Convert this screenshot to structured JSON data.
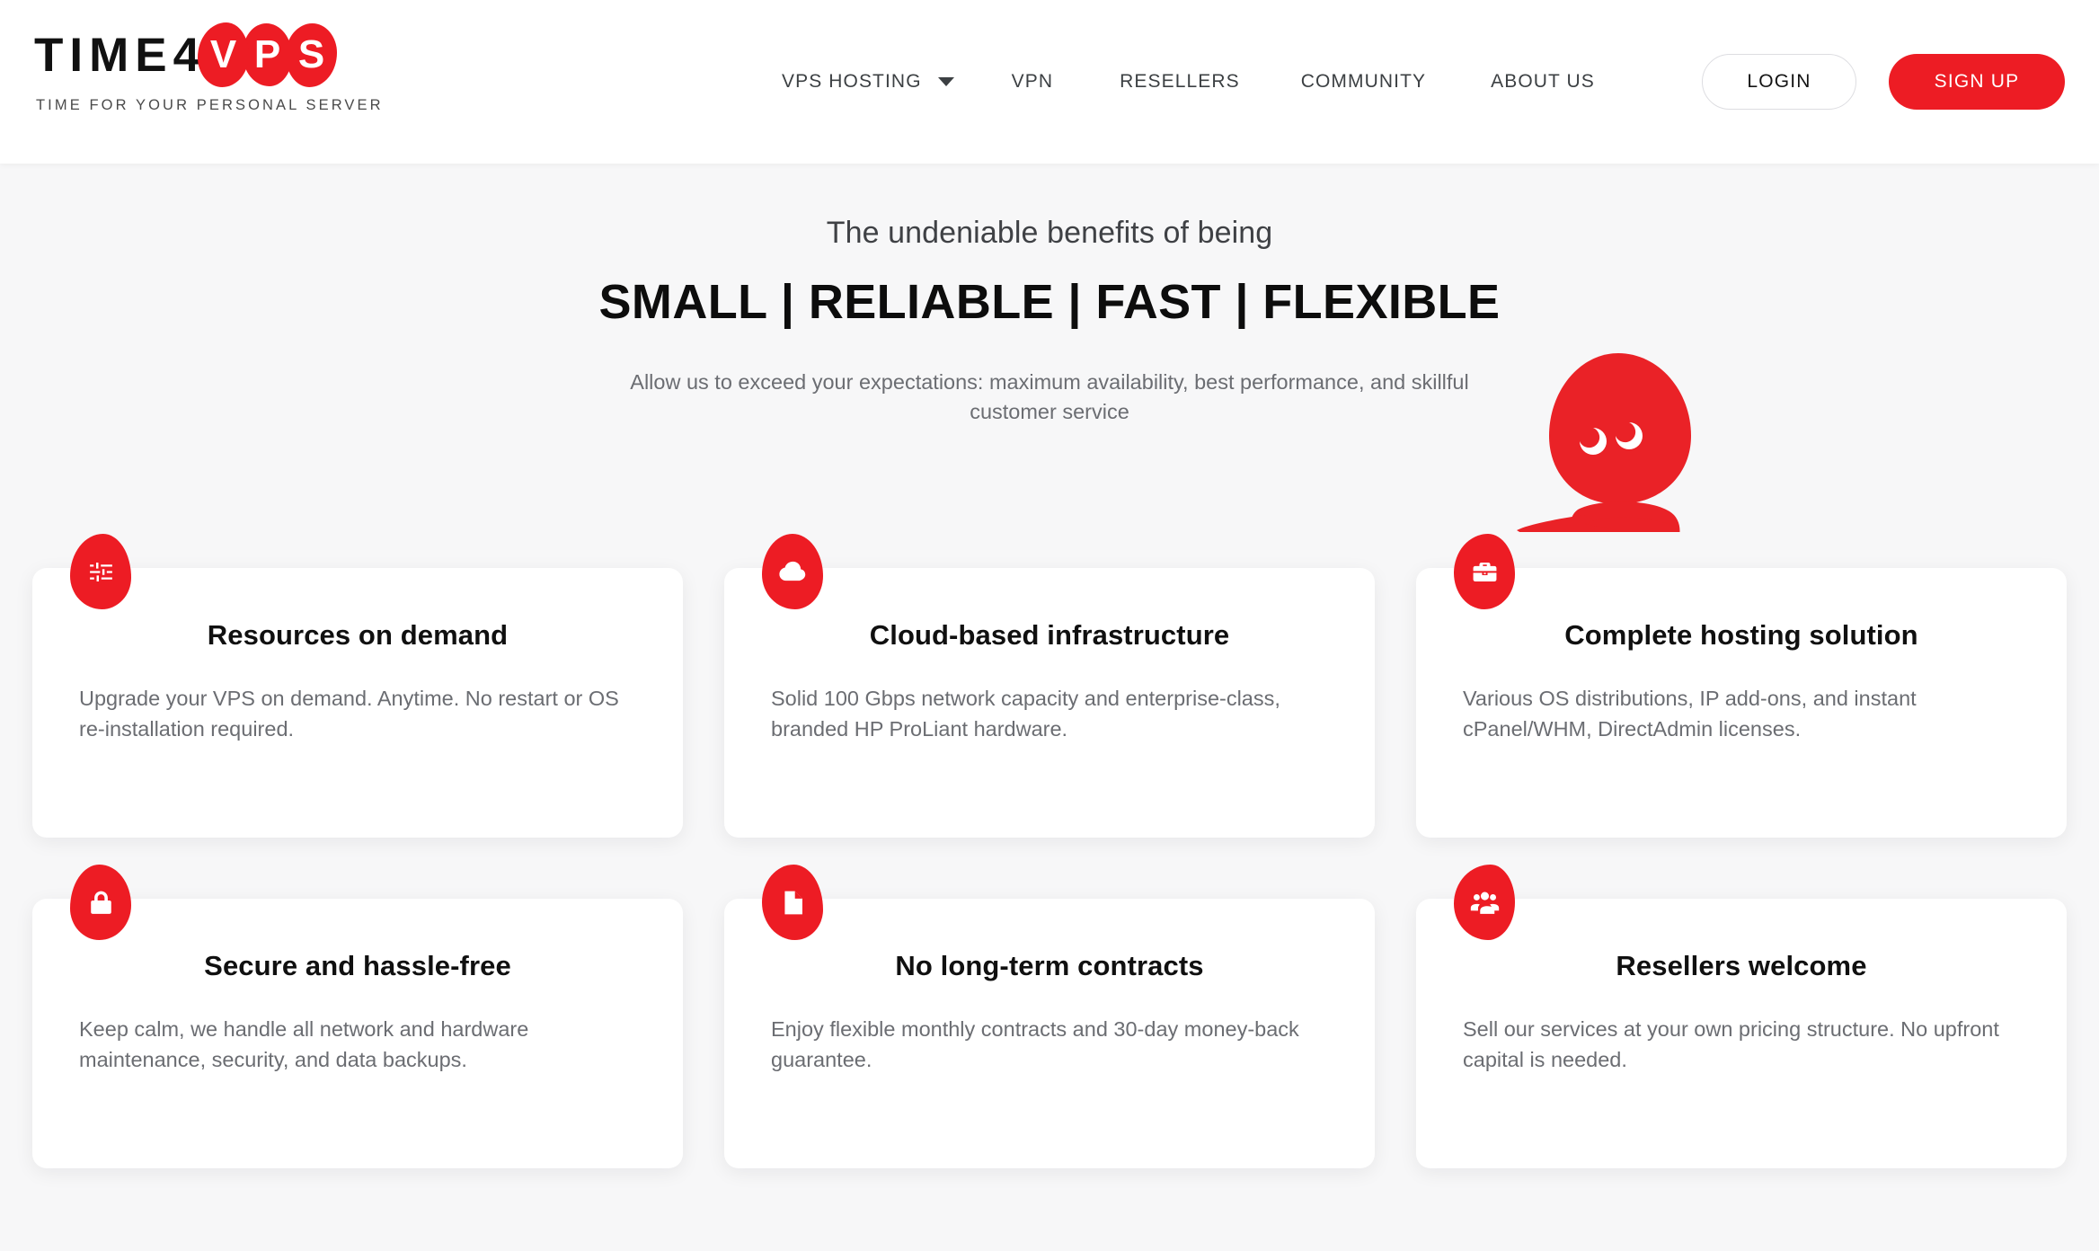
{
  "brand": {
    "name_dark": "TIME4",
    "blobs": [
      "V",
      "P",
      "S"
    ],
    "tagline": "TIME FOR YOUR PERSONAL SERVER",
    "accent_color": "#ed1c24"
  },
  "nav": {
    "items": [
      {
        "label": "VPS HOSTING",
        "has_dropdown": true
      },
      {
        "label": "VPN",
        "has_dropdown": false
      },
      {
        "label": "RESELLERS",
        "has_dropdown": false
      },
      {
        "label": "COMMUNITY",
        "has_dropdown": false
      },
      {
        "label": "ABOUT US",
        "has_dropdown": false
      }
    ],
    "login_label": "LOGIN",
    "signup_label": "SIGN UP"
  },
  "hero": {
    "kicker": "The undeniable benefits of being",
    "title": "SMALL | RELIABLE | FAST | FLEXIBLE",
    "subtitle": "Allow us to exceed your expectations: maximum availability, best performance, and skillful customer service",
    "mascot": "time4vps-mascot"
  },
  "cards": [
    {
      "icon": "sliders-icon",
      "title": "Resources on demand",
      "text": "Upgrade your VPS on demand. Anytime. No restart or OS re-installation required."
    },
    {
      "icon": "cloud-icon",
      "title": "Cloud-based infrastructure",
      "text": "Solid 100 Gbps network capacity and enterprise-class, branded HP ProLiant hardware."
    },
    {
      "icon": "briefcase-icon",
      "title": "Complete hosting solution",
      "text": "Various OS distributions, IP add-ons, and instant cPanel/WHM, DirectAdmin licenses."
    },
    {
      "icon": "lock-icon",
      "title": "Secure and hassle-free",
      "text": "Keep calm, we handle all network and hardware maintenance, security, and data backups."
    },
    {
      "icon": "document-icon",
      "title": "No long-term contracts",
      "text": "Enjoy flexible monthly contracts and 30-day money-back guarantee."
    },
    {
      "icon": "people-group-icon",
      "title": "Resellers welcome",
      "text": "Sell our services at your own pricing structure. No upfront capital is needed."
    }
  ]
}
